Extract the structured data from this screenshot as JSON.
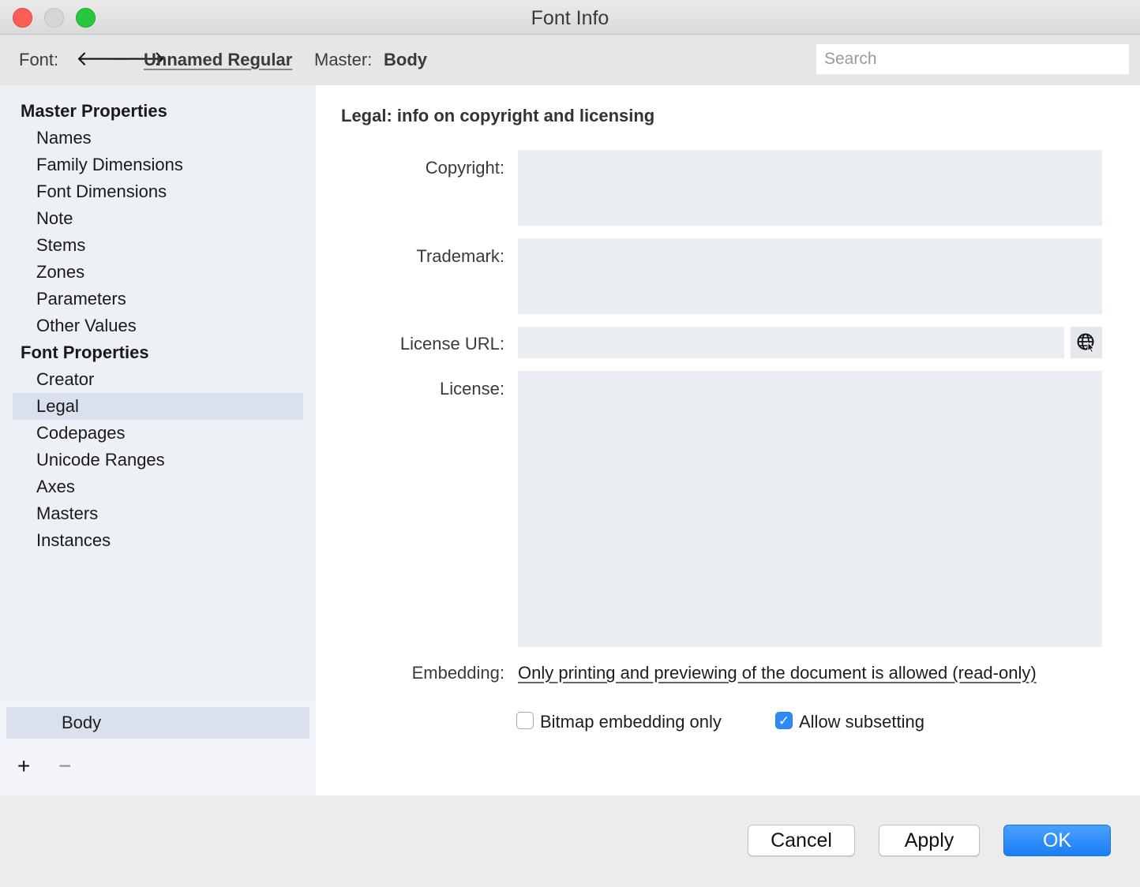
{
  "window": {
    "title": "Font Info"
  },
  "toolbar": {
    "font_label": "Font:",
    "back_icon": "arrow-left-icon",
    "forward_icon": "arrow-right-icon",
    "font_name": "Unnamed Regular",
    "master_label": "Master:",
    "master_name": "Body",
    "search_placeholder": "Search"
  },
  "sidebar": {
    "master_properties": {
      "heading": "Master Properties",
      "items": [
        "Names",
        "Family Dimensions",
        "Font Dimensions",
        "Note",
        "Stems",
        "Zones",
        "Parameters",
        "Other Values"
      ]
    },
    "font_properties": {
      "heading": "Font Properties",
      "items": [
        "Creator",
        "Legal",
        "Codepages",
        "Unicode Ranges",
        "Axes",
        "Masters",
        "Instances"
      ],
      "selected": "Legal"
    }
  },
  "masters_panel": {
    "items": [
      "Body"
    ],
    "add_label": "+",
    "remove_label": "−"
  },
  "main": {
    "title": "Legal: info on copyright and licensing",
    "copyright": {
      "label": "Copyright:",
      "value": ""
    },
    "trademark": {
      "label": "Trademark:",
      "value": ""
    },
    "license_url": {
      "label": "License URL:",
      "value": "",
      "icon": "globe-cursor-icon"
    },
    "license": {
      "label": "License:",
      "value": ""
    },
    "embedding": {
      "label": "Embedding:",
      "value": "Only printing and previewing of the document is allowed (read-only)"
    },
    "bitmap_embedding": {
      "label": "Bitmap embedding only",
      "checked": false
    },
    "allow_subsetting": {
      "label": "Allow subsetting",
      "checked": true
    }
  },
  "footer": {
    "cancel": "Cancel",
    "apply": "Apply",
    "ok": "OK"
  },
  "colors": {
    "accent": "#1a7ef5",
    "sidebar_bg": "#edf0f5",
    "selection": "#dbe0ef",
    "field_bg": "#eaeef2"
  }
}
